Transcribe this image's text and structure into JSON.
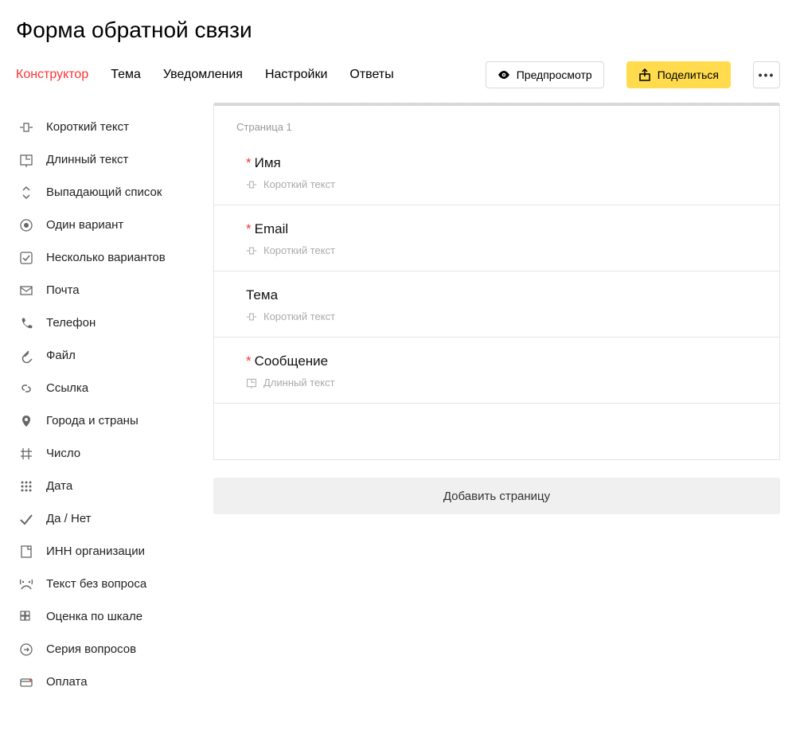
{
  "title": "Форма обратной связи",
  "tabs": {
    "constructor": "Конструктор",
    "theme": "Тема",
    "notifications": "Уведомления",
    "settings": "Настройки",
    "answers": "Ответы"
  },
  "toolbar": {
    "preview": "Предпросмотр",
    "share": "Поделиться"
  },
  "sidebar": [
    {
      "id": "short-text",
      "label": "Короткий текст"
    },
    {
      "id": "long-text",
      "label": "Длинный текст"
    },
    {
      "id": "dropdown",
      "label": "Выпадающий список"
    },
    {
      "id": "radio",
      "label": "Один вариант"
    },
    {
      "id": "checkbox",
      "label": "Несколько вариантов"
    },
    {
      "id": "email",
      "label": "Почта"
    },
    {
      "id": "phone",
      "label": "Телефон"
    },
    {
      "id": "file",
      "label": "Файл"
    },
    {
      "id": "link",
      "label": "Ссылка"
    },
    {
      "id": "location",
      "label": "Города и страны"
    },
    {
      "id": "number",
      "label": "Число"
    },
    {
      "id": "date",
      "label": "Дата"
    },
    {
      "id": "boolean",
      "label": "Да / Нет"
    },
    {
      "id": "org-id",
      "label": "ИНН организации"
    },
    {
      "id": "text-block",
      "label": "Текст без вопроса"
    },
    {
      "id": "rating",
      "label": "Оценка по шкале"
    },
    {
      "id": "series",
      "label": "Серия вопросов"
    },
    {
      "id": "payment",
      "label": "Оплата"
    }
  ],
  "page": {
    "label": "Страница 1",
    "questions": [
      {
        "required": true,
        "title": "Имя",
        "type_label": "Короткий текст",
        "type_icon": "short-text"
      },
      {
        "required": true,
        "title": "Email",
        "type_label": "Короткий текст",
        "type_icon": "short-text"
      },
      {
        "required": false,
        "title": "Тема",
        "type_label": "Короткий текст",
        "type_icon": "short-text"
      },
      {
        "required": true,
        "title": "Сообщение",
        "type_label": "Длинный текст",
        "type_icon": "long-text"
      }
    ]
  },
  "add_page_label": "Добавить страницу"
}
